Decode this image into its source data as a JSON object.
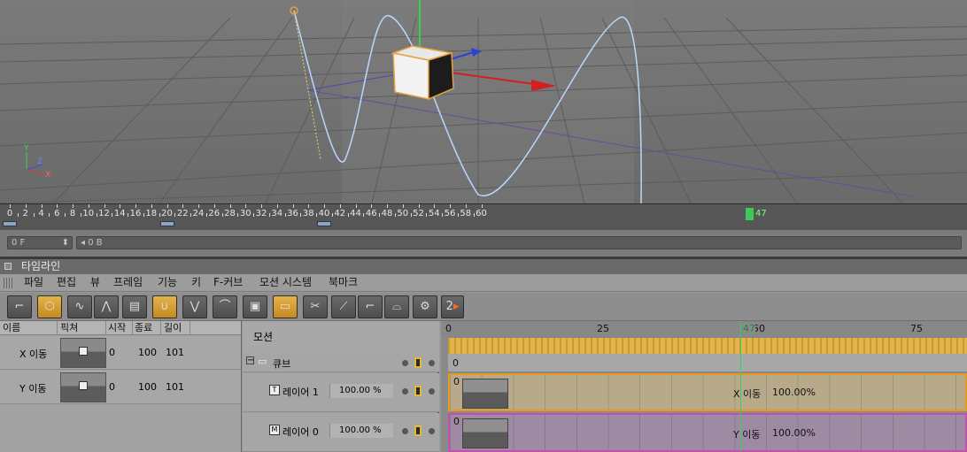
{
  "viewport": {
    "axis_labels": {
      "y": "Y",
      "z": "Z",
      "x": "X"
    }
  },
  "ruler": {
    "labels": [
      "0",
      "2",
      "4",
      "6",
      "8",
      "10",
      "12",
      "14",
      "16",
      "18",
      "20",
      "22",
      "24",
      "26",
      "28",
      "30",
      "32",
      "34",
      "36",
      "38",
      "40",
      "42",
      "44",
      "46",
      "48",
      "50",
      "52",
      "54",
      "56",
      "58",
      "60"
    ],
    "current_frame": "47"
  },
  "framebar": {
    "frame_field": "0 F",
    "second_field": "◂ 0 B"
  },
  "window": {
    "title": "타임라인"
  },
  "menu": [
    "파일",
    "편집",
    "뷰",
    "프레임",
    "기능",
    "키",
    "F-커브",
    "모션 시스템",
    "북마크"
  ],
  "toolbar": {
    "page_number": "2"
  },
  "columns": {
    "name": "이름",
    "picture": "픽쳐",
    "start": "시작",
    "end": "종료",
    "length": "길이"
  },
  "tracks": [
    {
      "name": "X 이동",
      "start": "0",
      "end": "100",
      "length": "101"
    },
    {
      "name": "Y 이동",
      "start": "0",
      "end": "100",
      "length": "101"
    }
  ],
  "motion": {
    "header": "모션",
    "group": "큐브",
    "layers": [
      {
        "name": "레이어 1",
        "value": "100.00 %"
      },
      {
        "name": "레이어 0",
        "value": "100.00 %"
      }
    ]
  },
  "timeline": {
    "ruler": [
      "0",
      "25",
      "50",
      "75"
    ],
    "current": "47",
    "cube_row_start": "0",
    "clips": [
      {
        "start": "0",
        "label": "X 이동",
        "value": "100.00%"
      },
      {
        "start": "0",
        "label": "Y 이동",
        "value": "100.00%"
      }
    ]
  },
  "colors": {
    "accent_orange": "#e69a1c",
    "playhead": "#35d060",
    "clip_x": "#b7a98a",
    "clip_y": "#9f8aa4"
  }
}
